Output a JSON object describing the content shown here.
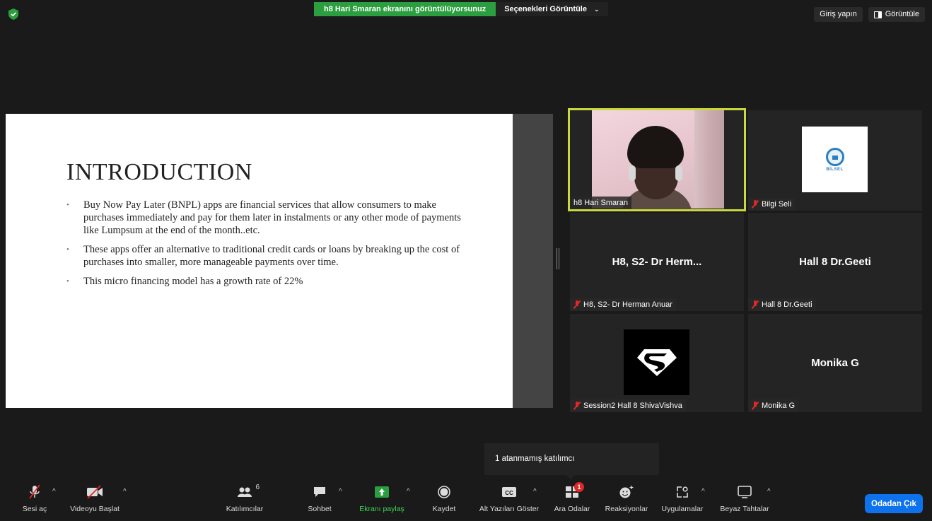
{
  "top": {
    "share_banner": "h8 Hari Smaran ekranını görüntülüyorsunuz",
    "view_options": "Seçenekleri Görüntüle",
    "login": "Giriş yapın",
    "view": "Görüntüle"
  },
  "slide": {
    "title": "INTRODUCTION",
    "bullets": [
      "Buy Now Pay Later (BNPL) apps are financial services that allow consumers to make purchases immediately and pay for them later in instalments or any other mode of payments like Lumpsum at the end of the month..etc.",
      "These apps offer an alternative to traditional credit cards or loans by breaking up the cost of purchases into smaller, more manageable payments over time.",
      "This micro financing model has a growth rate of 22%"
    ]
  },
  "participants": [
    {
      "name": "h8 Hari Smaran",
      "muted": false,
      "tile_title": ""
    },
    {
      "name": "Bilgi Seli",
      "muted": true,
      "tile_title": "",
      "logo_text": "BİLSEL"
    },
    {
      "name": "H8, S2- Dr Herman Anuar",
      "muted": true,
      "tile_title": "H8, S2- Dr Herm..."
    },
    {
      "name": "Hall 8 Dr.Geeti",
      "muted": true,
      "tile_title": "Hall 8 Dr.Geeti"
    },
    {
      "name": "Session2 Hall 8 ShivaVishva",
      "muted": true,
      "tile_title": ""
    },
    {
      "name": "Monika G",
      "muted": true,
      "tile_title": "Monika G"
    }
  ],
  "tooltip": "1 atanmamış katılımcı",
  "toolbar": {
    "unmute": "Sesi aç",
    "start_video": "Videoyu Başlat",
    "participants": "Katılımcılar",
    "participants_count": "6",
    "chat": "Sohbet",
    "share_screen": "Ekranı paylaş",
    "record": "Kaydet",
    "captions": "Alt Yazıları Göster",
    "captions_icon": "CC",
    "breakout": "Ara Odalar",
    "breakout_badge": "1",
    "reactions": "Reaksiyonlar",
    "apps": "Uygulamalar",
    "whiteboards": "Beyaz Tahtalar",
    "leave": "Odadan Çık"
  },
  "colors": {
    "share_green": "#2b9e3f",
    "active_speaker": "#c9d83e",
    "leave_blue": "#0e72ed",
    "muted_red": "#e02828"
  }
}
